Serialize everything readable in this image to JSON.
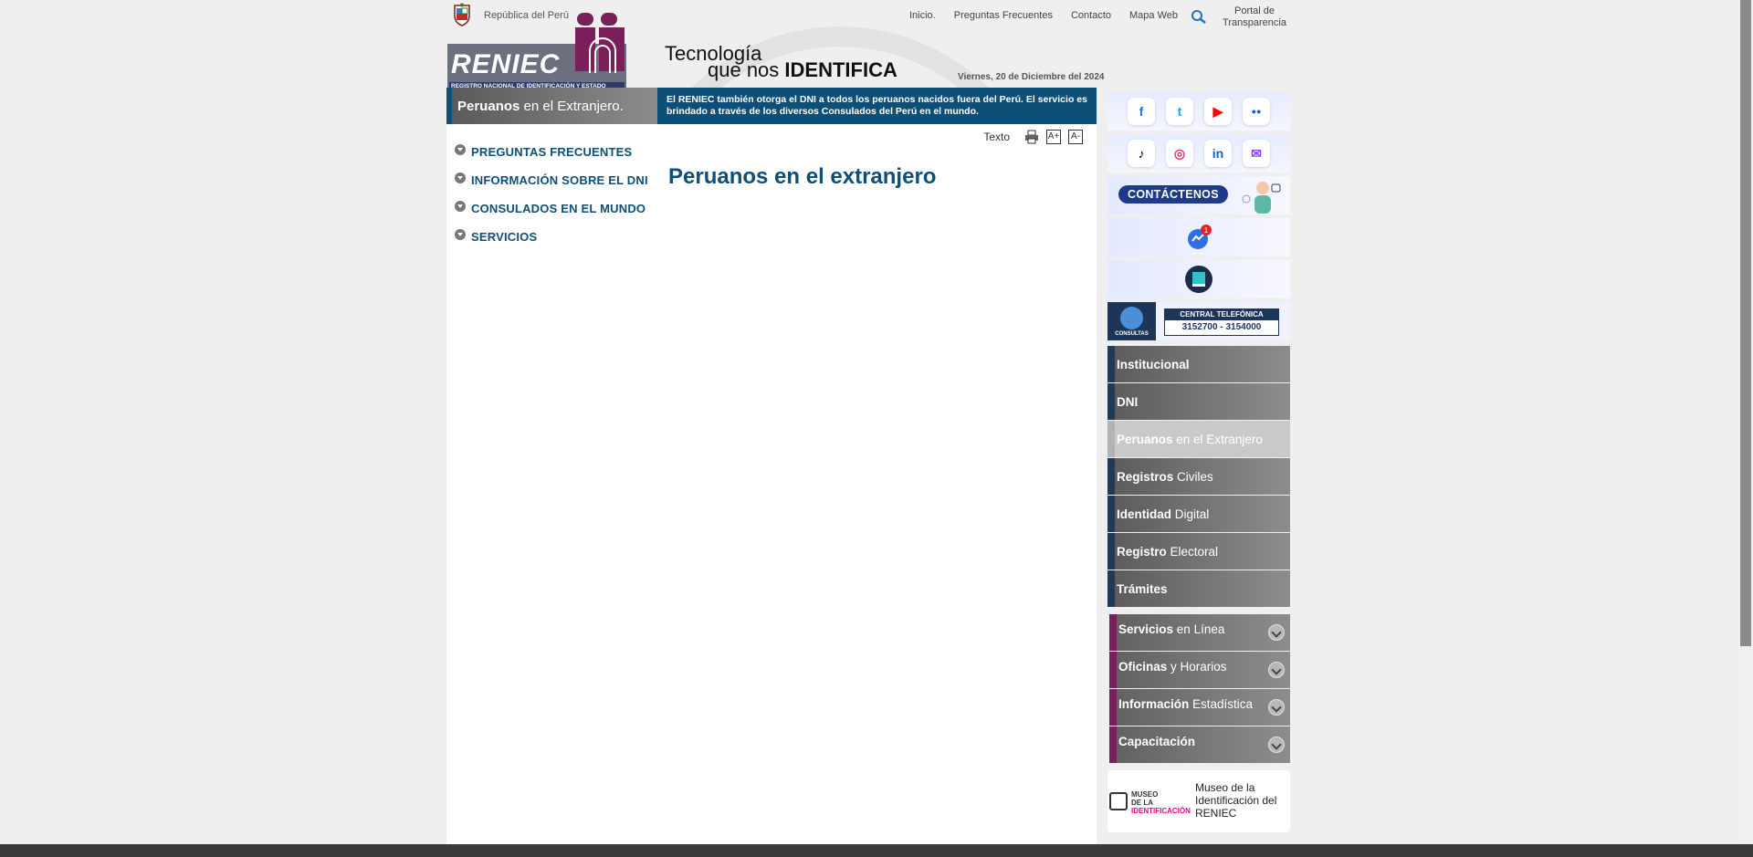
{
  "topbar": {
    "gov_label": "República del Perú",
    "links": [
      "Inicio.",
      "Preguntas Frecuentes",
      "Contacto",
      "Mapa Web"
    ],
    "portal_line1": "Portal de",
    "portal_line2": "Transparencia"
  },
  "header": {
    "logo_text": "RENIEC",
    "logo_subtitle": "REGISTRO NACIONAL DE IDENTIFICACIÓN Y ESTADO CIVIL",
    "slogan_line1": "Tecnología",
    "slogan_line2_a": "que nos ",
    "slogan_line2_b": "IDENTIFICA",
    "date": "Viernes, 20 de Diciembre del 2024"
  },
  "section": {
    "tab_bold": "Peruanos",
    "tab_rest": " en el Extranjero.",
    "notice": "El RENIEC también otorga el DNI a todos los peruanos nacidos fuera del Perú. El servicio es brindado a través de los diversos Consulados del Perú en el mundo."
  },
  "leftnav": [
    "PREGUNTAS FRECUENTES",
    "INFORMACIÓN SOBRE EL DNI",
    "CONSULADOS EN EL MUNDO",
    "SERVICIOS"
  ],
  "tools": {
    "label": "Texto",
    "bigger": "A+",
    "smaller": "A-"
  },
  "main": {
    "title": "Peruanos en el extranjero"
  },
  "sidebar": {
    "social_row1": [
      "f",
      "t",
      "▶",
      "●●"
    ],
    "social_row2": [
      "♪",
      "◎",
      "in",
      "✉"
    ],
    "contact_label": "CONTÁCTENOS",
    "badge_count": "1",
    "phone_left": "CONSULTAS",
    "phone_title": "CENTRAL TELEFÓNICA",
    "phone_numbers": "3152700 - 3154000",
    "menu": [
      {
        "bold": "Institucional",
        "rest": ""
      },
      {
        "bold": "DNI",
        "rest": ""
      },
      {
        "bold": "Peruanos",
        "rest": " en el Extranjero"
      },
      {
        "bold": "Registros",
        "rest": " Civiles"
      },
      {
        "bold": "Identidad",
        "rest": " Digital"
      },
      {
        "bold": "Registro",
        "rest": " Electoral"
      },
      {
        "bold": "Trámites",
        "rest": ""
      }
    ],
    "submenu": [
      {
        "bold": "Servicios",
        "rest": " en Línea"
      },
      {
        "bold": "Oficinas",
        "rest": " y Horarios"
      },
      {
        "bold": "Información",
        "rest": " Estadística"
      },
      {
        "bold": "Capacitación",
        "rest": ""
      }
    ],
    "museo_logo_a": "MUSEO",
    "museo_logo_b": "DE LA",
    "museo_logo_c": "IDENTIFICACIÓN",
    "museo_text": "Museo de la Identificación del RENIEC"
  },
  "colors": {
    "brand_blue": "#0e4f78",
    "accent_purple": "#7a1f5c",
    "menu_gray": "#6f6f6f"
  }
}
